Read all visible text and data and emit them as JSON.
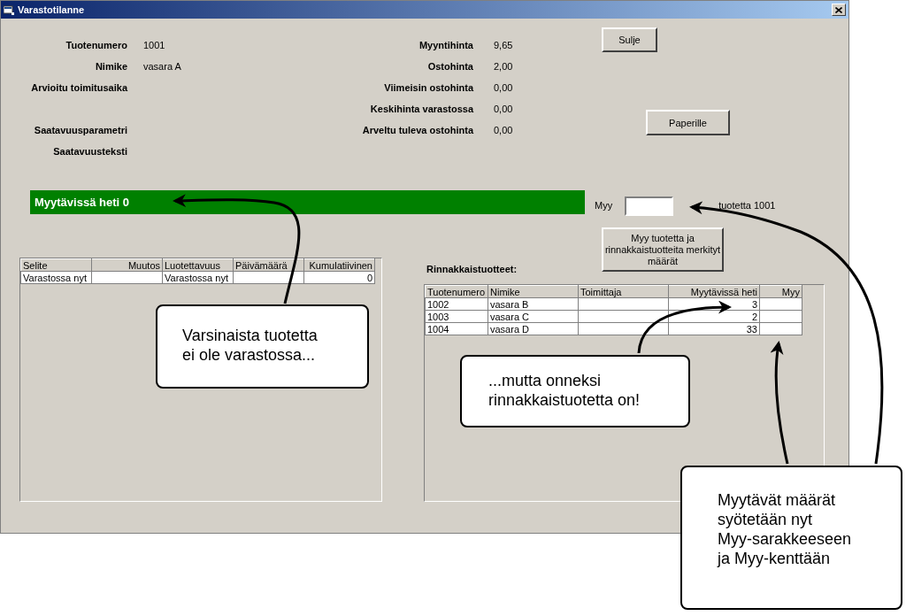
{
  "window": {
    "title": "Varastotilanne"
  },
  "product_fields": [
    {
      "label": "Tuotenumero",
      "value": "1001"
    },
    {
      "label": "Nimike",
      "value": "vasara A"
    },
    {
      "label": "Arvioitu toimitusaika"
    },
    {
      "label": "Saatavuusparametri"
    },
    {
      "label": "Saatavuusteksti"
    }
  ],
  "prices": [
    {
      "label": "Myyntihinta",
      "value": "9,65"
    },
    {
      "label": "Ostohinta",
      "value": "2,00"
    },
    {
      "label": "Viimeisin ostohinta",
      "value": "0,00"
    },
    {
      "label": "Keskihinta varastossa",
      "value": "0,00"
    },
    {
      "label": "Arveltu tuleva ostohinta",
      "value": "0,00"
    }
  ],
  "buttons": [
    {
      "label": "Sulje",
      "kind": "close"
    },
    {
      "label": "Paperille",
      "kind": "print"
    }
  ],
  "availability_bar": {
    "text": "Myytävissä heti 0"
  },
  "sell_field": {
    "label": "Myy",
    "suffix": "tuotetta 1001"
  },
  "sell_button": {
    "label": "Myy tuotetta ja rinnakkaistuotteita merkityt määrät"
  },
  "stock_table": {
    "columns": [
      "Selite",
      "Muutos",
      "Luotettavuus",
      "Päivämäärä",
      "Kumulatiivinen"
    ],
    "rows": [
      [
        "Varastossa nyt",
        null,
        "Varastossa nyt",
        null,
        "0"
      ]
    ]
  },
  "parallel_products": {
    "heading": "Rinnakkaistuotteet:",
    "columns": [
      "Tuotenumero",
      "Nimike",
      "Toimittaja",
      "Myytävissä heti",
      "Myy"
    ],
    "rows": [
      [
        "1002",
        "vasara B",
        null,
        "3",
        null
      ],
      [
        "1003",
        "vasara C",
        null,
        "2",
        null
      ],
      [
        "1004",
        "vasara D",
        null,
        "33",
        null
      ]
    ]
  },
  "callouts": [
    {
      "text": "Varsinaista tuotetta\nei ole varastossa..."
    },
    {
      "text": "...mutta onneksi\nrinnakkaistuotetta on!"
    },
    {
      "text": "Myytävät määrät\nsyötetään nyt\nMyy-sarakkeeseen\nja Myy-kenttään"
    }
  ]
}
